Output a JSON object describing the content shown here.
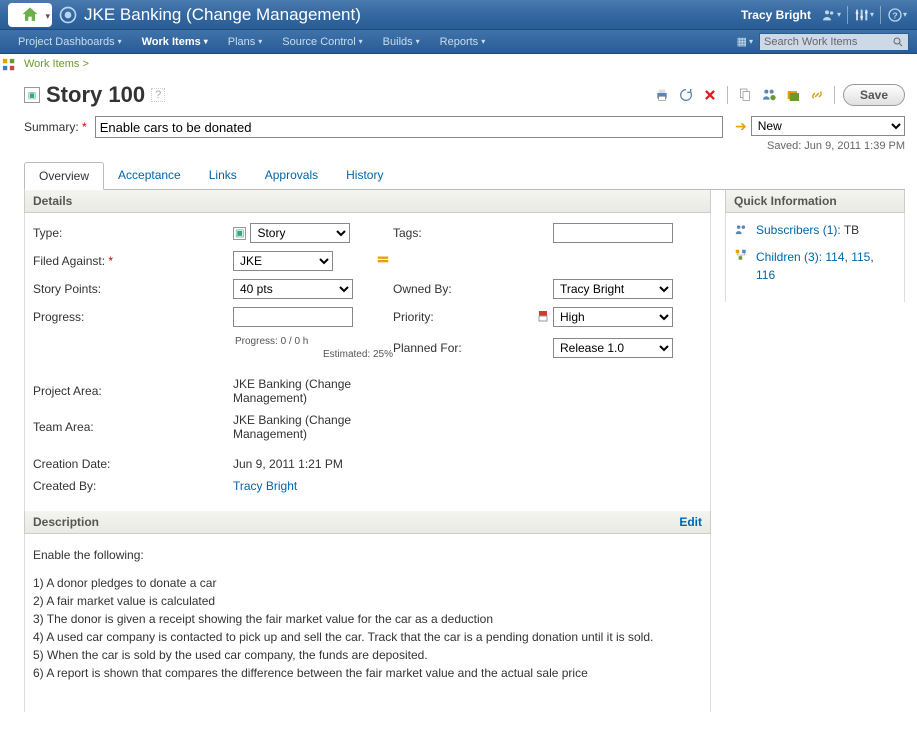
{
  "banner": {
    "title": "JKE Banking (Change Management)",
    "user": "Tracy Bright"
  },
  "nav": {
    "items": [
      {
        "label": "Project Dashboards"
      },
      {
        "label": "Work Items",
        "active": true
      },
      {
        "label": "Plans"
      },
      {
        "label": "Source Control"
      },
      {
        "label": "Builds"
      },
      {
        "label": "Reports"
      }
    ],
    "search_placeholder": "Search Work Items"
  },
  "breadcrumb": {
    "label": "Work Items",
    "sep": ">"
  },
  "workitem": {
    "title": "Story 100",
    "summary_label": "Summary:",
    "summary": "Enable cars to be donated",
    "state": "New",
    "saved_text": "Saved: Jun 9, 2011 1:39 PM",
    "save_button": "Save"
  },
  "tabs": [
    "Overview",
    "Acceptance",
    "Links",
    "Approvals",
    "History"
  ],
  "details": {
    "heading": "Details",
    "type_label": "Type:",
    "type": "Story",
    "filed_label": "Filed Against:",
    "filed": "JKE",
    "points_label": "Story Points:",
    "points": "40 pts",
    "progress_label": "Progress:",
    "progress_text": "Progress: 0 / 0 h",
    "estimated_text": "Estimated: 25%",
    "project_label": "Project Area:",
    "project": "JKE Banking (Change Management)",
    "team_label": "Team Area:",
    "team": "JKE Banking (Change Management)",
    "created_date_label": "Creation Date:",
    "created_date": "Jun 9, 2011 1:21 PM",
    "created_by_label": "Created By:",
    "created_by": "Tracy Bright",
    "tags_label": "Tags:",
    "tags": "",
    "owned_label": "Owned By:",
    "owned": "Tracy Bright",
    "priority_label": "Priority:",
    "priority": "High",
    "planned_label": "Planned For:",
    "planned": "Release 1.0"
  },
  "quickinfo": {
    "heading": "Quick Information",
    "subs_label": "Subscribers (1):",
    "subs_val": "TB",
    "children_label": "Children (3):",
    "children": [
      "114",
      "115",
      "116"
    ]
  },
  "description": {
    "heading": "Description",
    "edit": "Edit",
    "intro": "Enable the following:",
    "items": [
      "1) A donor pledges to donate a car",
      "2) A fair market value is calculated",
      "3) The donor is given a receipt showing the fair market value for the car as a deduction",
      "4) A used car company is contacted to pick up and sell the car. Track that the car is a pending donation until it is sold.",
      "5) When the car is sold by the used car company, the funds are deposited.",
      "6) A report is shown that compares the difference between the fair market value and the actual sale price"
    ]
  }
}
